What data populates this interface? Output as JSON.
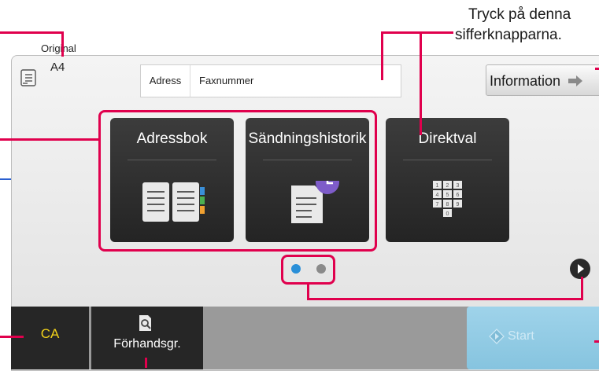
{
  "callouts": {
    "top_right_line1": "Tryck på denna",
    "top_right_line2": "sifferknapparna."
  },
  "original": {
    "label": "Original",
    "size": "A4"
  },
  "address": {
    "label": "Adress",
    "value": "Faxnummer"
  },
  "information_button": "Information",
  "tiles": [
    {
      "label": "Adressbok",
      "icon": "address-book-icon"
    },
    {
      "label": "Sändningshistorik",
      "icon": "history-icon"
    },
    {
      "label": "Direktval",
      "icon": "keypad-icon"
    }
  ],
  "keypad_digits": [
    "1",
    "2",
    "3",
    "4",
    "5",
    "6",
    "7",
    "8",
    "9",
    "0"
  ],
  "pagination": {
    "pages": 2,
    "current": 1
  },
  "bottom": {
    "ca": "CA",
    "preview": "Förhandsgr.",
    "start": "Start"
  },
  "colors": {
    "callout_red": "#e0004d",
    "tile_bg": "#2e2e2e",
    "ca_text": "#f2d21a",
    "start_bg": "#9fd3ea",
    "dot_active": "#2a8fd8"
  }
}
